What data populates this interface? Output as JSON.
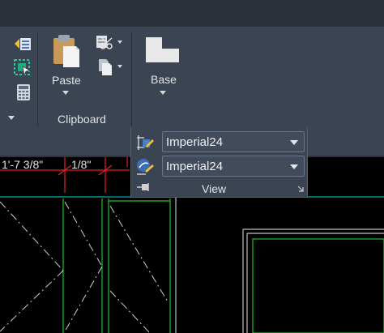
{
  "ribbon": {
    "panels": [
      {
        "name": "Clipboard",
        "buttons": [
          {
            "label": "Paste"
          }
        ]
      },
      {
        "name": "View",
        "buttons": [
          {
            "label": "Base"
          }
        ]
      }
    ]
  },
  "view_panel": {
    "title": "View",
    "dimstyle_dropdown": {
      "value": "Imperial24"
    },
    "multileader_dropdown": {
      "value": "Imperial24"
    }
  },
  "drawing": {
    "ruler_labels": [
      "1'-7 3/8\"",
      "1/8\""
    ]
  },
  "colors": {
    "ribbon_bg": "#3b4453",
    "canvas_bg": "#000000",
    "green_lines": "#1fbf2a",
    "red_dims": "#e0202a",
    "cyan_line": "#0ea8a8"
  }
}
